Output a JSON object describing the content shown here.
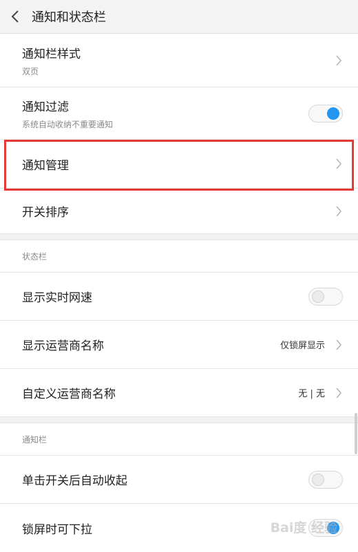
{
  "header": {
    "title": "通知和状态栏"
  },
  "notification_settings": {
    "style": {
      "label": "通知栏样式",
      "sub": "双页"
    },
    "filter": {
      "label": "通知过滤",
      "sub": "系统自动收纳不重要通知",
      "enabled": true
    },
    "manage": {
      "label": "通知管理"
    },
    "order": {
      "label": "开关排序"
    }
  },
  "status_bar": {
    "section_label": "状态栏",
    "realtime_speed": {
      "label": "显示实时网速",
      "enabled": false
    },
    "carrier_name": {
      "label": "显示运营商名称",
      "value": "仅锁屏显示"
    },
    "custom_carrier": {
      "label": "自定义运营商名称",
      "value": "无 | 无"
    }
  },
  "notification_bar": {
    "section_label": "通知栏",
    "auto_collapse": {
      "label": "单击开关后自动收起",
      "enabled": false
    },
    "lockscreen_pull": {
      "label": "锁屏时可下拉",
      "enabled": true
    }
  },
  "watermark": "Bai度 经验",
  "colors": {
    "accent": "#2196f3",
    "highlight": "#e53935"
  }
}
